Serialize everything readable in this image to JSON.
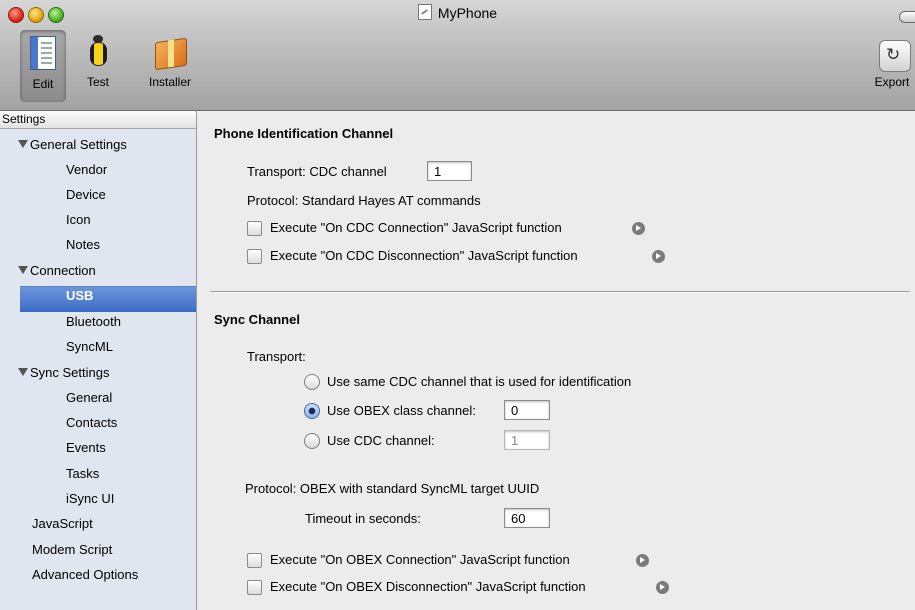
{
  "window": {
    "title": "MyPhone"
  },
  "toolbar": {
    "edit": "Edit",
    "test": "Test",
    "installer": "Installer",
    "export": "Export"
  },
  "sidebar": {
    "header": "Settings",
    "general_settings": "General Settings",
    "vendor": "Vendor",
    "device": "Device",
    "icon": "Icon",
    "notes": "Notes",
    "connection": "Connection",
    "usb": "USB",
    "bluetooth": "Bluetooth",
    "syncml": "SyncML",
    "sync_settings": "Sync Settings",
    "general": "General",
    "contacts": "Contacts",
    "events": "Events",
    "tasks": "Tasks",
    "isync_ui": "iSync UI",
    "javascript": "JavaScript",
    "modem_script": "Modem Script",
    "advanced_options": "Advanced Options",
    "selected": "USB"
  },
  "phone_id": {
    "heading": "Phone Identification Channel",
    "transport_label": "Transport: CDC channel",
    "transport_value": "1",
    "protocol": "Protocol: Standard Hayes AT commands",
    "cdc_connection_label": "Execute \"On CDC Connection\" JavaScript function",
    "cdc_connection_checked": false,
    "cdc_disconnection_label": "Execute \"On CDC Disconnection\" JavaScript function",
    "cdc_disconnection_checked": false
  },
  "sync": {
    "heading": "Sync Channel",
    "transport_label": "Transport:",
    "option_same_cdc": "Use same CDC channel that is used for identification",
    "option_obex": "Use OBEX class channel:",
    "obex_value": "0",
    "option_cdc": "Use CDC channel:",
    "cdc_value": "1",
    "selected_option": "Use OBEX class channel:",
    "protocol": "Protocol: OBEX with standard SyncML target UUID",
    "timeout_label": "Timeout in seconds:",
    "timeout_value": "60",
    "obex_connection_label": "Execute \"On OBEX Connection\" JavaScript function",
    "obex_connection_checked": false,
    "obex_disconnection_label": "Execute \"On OBEX Disconnection\" JavaScript function",
    "obex_disconnection_checked": false
  },
  "colors": {
    "selection": "#3a6cc7",
    "sidebar_bg": "#dfe6f0",
    "content_bg": "#ececec"
  }
}
